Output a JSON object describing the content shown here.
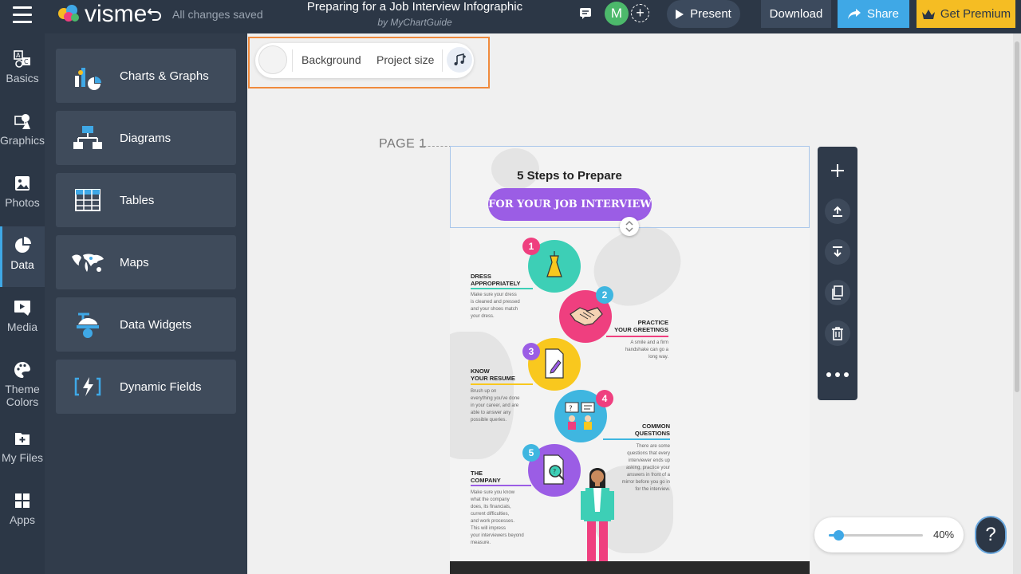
{
  "header": {
    "logo_text": "visme",
    "save_status": "All changes saved",
    "doc_title": "Preparing for a Job Interview Infographic",
    "doc_subtitle": "by MyChartGuide",
    "avatar_initial": "M",
    "present_label": "Present",
    "download_label": "Download",
    "share_label": "Share",
    "premium_label": "Get Premium"
  },
  "rail": {
    "items": [
      {
        "label": "Basics",
        "icon": "basics-icon"
      },
      {
        "label": "Graphics",
        "icon": "graphics-icon"
      },
      {
        "label": "Photos",
        "icon": "photos-icon"
      },
      {
        "label": "Data",
        "icon": "data-icon"
      },
      {
        "label": "Media",
        "icon": "media-icon"
      },
      {
        "label": "Theme",
        "label2": "Colors",
        "icon": "theme-colors-icon"
      },
      {
        "label": "My Files",
        "icon": "my-files-icon"
      },
      {
        "label": "Apps",
        "icon": "apps-icon"
      }
    ],
    "active": "Data"
  },
  "panel": {
    "items": [
      {
        "label": "Charts & Graphs",
        "icon": "charts-icon"
      },
      {
        "label": "Diagrams",
        "icon": "diagrams-icon"
      },
      {
        "label": "Tables",
        "icon": "tables-icon"
      },
      {
        "label": "Maps",
        "icon": "maps-icon"
      },
      {
        "label": "Data Widgets",
        "icon": "data-widgets-icon"
      },
      {
        "label": "Dynamic Fields",
        "icon": "dynamic-fields-icon"
      }
    ]
  },
  "toolbar": {
    "background_label": "Background",
    "project_size_label": "Project size"
  },
  "canvas": {
    "page_label": "PAGE 1"
  },
  "infographic": {
    "title": "5 Steps to Prepare",
    "pill_text": "FOR YOUR JOB INTERVIEW",
    "steps": [
      {
        "num": "1",
        "head1": "DRESS",
        "head2": "APPROPRIATELY",
        "body": [
          "Make sure your dress",
          "is cleaned and pressed",
          "and your shoes match",
          "your dress."
        ],
        "color": "#3dcfb6",
        "badge": "#ef3f7f"
      },
      {
        "num": "2",
        "head1": "PRACTICE",
        "head2": "YOUR GREETINGS",
        "body": [
          "A smile and a firm",
          "handshake can go a",
          "long way."
        ],
        "color": "#ef3f7f",
        "badge": "#3fb6e0"
      },
      {
        "num": "3",
        "head1": "KNOW",
        "head2": "YOUR RESUME",
        "body": [
          "Brush up on",
          "everything you've done",
          "in your career, and are",
          "able to answer any",
          "possible queries."
        ],
        "color": "#f9c81e",
        "badge": "#9b5de5"
      },
      {
        "num": "4",
        "head1": "COMMON",
        "head2": "QUESTIONS",
        "body": [
          "There are some",
          "questions that every",
          "interviewer ends up",
          "asking, practice your",
          "answers in front of a",
          "mirror before you go in",
          "for the interview."
        ],
        "color": "#3fb6e0",
        "badge": "#ef3f7f"
      },
      {
        "num": "5",
        "head1": "THE",
        "head2": "COMPANY",
        "body": [
          "Make sure you know",
          "what the company",
          "does, its financials,",
          "current difficulties,",
          "and work processes.",
          "This will impress",
          "your interviewers beyond",
          "measure."
        ],
        "color": "#9b5de5",
        "badge": "#3fb6e0"
      }
    ]
  },
  "zoom": {
    "value_label": "40%",
    "level": 0.1
  },
  "help": {
    "label": "?"
  },
  "colors": {
    "topbar": "#2c3746",
    "accent_blue": "#3fa8e6",
    "premium_yellow": "#f5bd23",
    "highlight_orange": "#f08a3c",
    "pill_purple": "#9b5de5"
  }
}
